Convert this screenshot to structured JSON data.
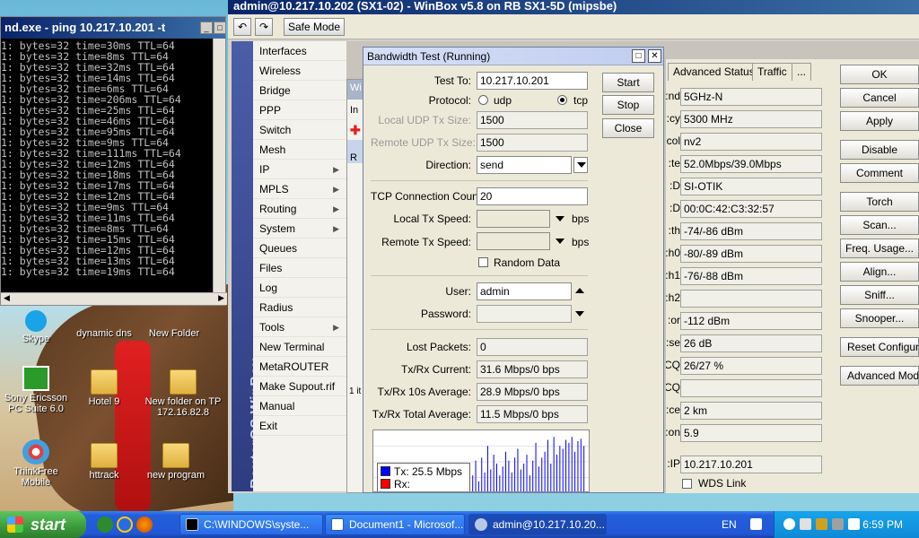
{
  "console": {
    "title": "nd.exe - ping 10.217.10.201 -t",
    "lines": [
      "1: bytes=32 time=30ms TTL=64",
      "1: bytes=32 time=8ms TTL=64",
      "1: bytes=32 time=32ms TTL=64",
      "1: bytes=32 time=14ms TTL=64",
      "1: bytes=32 time=6ms TTL=64",
      "1: bytes=32 time=206ms TTL=64",
      "1: bytes=32 time=25ms TTL=64",
      "1: bytes=32 time=46ms TTL=64",
      "1: bytes=32 time=95ms TTL=64",
      "1: bytes=32 time=9ms TTL=64",
      "1: bytes=32 time=111ms TTL=64",
      "1: bytes=32 time=12ms TTL=64",
      "1: bytes=32 time=18ms TTL=64",
      "1: bytes=32 time=17ms TTL=64",
      "1: bytes=32 time=12ms TTL=64",
      "1: bytes=32 time=9ms TTL=64",
      "1: bytes=32 time=11ms TTL=64",
      "1: bytes=32 time=8ms TTL=64",
      "1: bytes=32 time=15ms TTL=64",
      "1: bytes=32 time=12ms TTL=64",
      "1: bytes=32 time=13ms TTL=64",
      "1: bytes=32 time=19ms TTL=64"
    ]
  },
  "desktop_icons": {
    "skype": "Skype",
    "dynamic_dns": "dynamic dns",
    "new_folder": "New Folder",
    "sony": "Sony Ericsson PC Suite 6.0",
    "hotel": "Hotel 9",
    "new_folder_on": "New folder on  TP 172.16.82.8",
    "thinkfree": "ThinkFree Mobile",
    "httrack": "httrack",
    "new_program": "new program"
  },
  "winbox": {
    "title": "admin@10.217.10.202 (SX1-02) - WinBox v5.8 on RB SX1-5D (mipsbe)",
    "safe_mode": "Safe Mode",
    "side_brand": "RouterOS WinBox",
    "menu": [
      {
        "label": "Interfaces",
        "arrow": ""
      },
      {
        "label": "Wireless",
        "arrow": ""
      },
      {
        "label": "Bridge",
        "arrow": ""
      },
      {
        "label": "PPP",
        "arrow": ""
      },
      {
        "label": "Switch",
        "arrow": ""
      },
      {
        "label": "Mesh",
        "arrow": ""
      },
      {
        "label": "IP",
        "arrow": "▶"
      },
      {
        "label": "MPLS",
        "arrow": "▶"
      },
      {
        "label": "Routing",
        "arrow": "▶"
      },
      {
        "label": "System",
        "arrow": "▶"
      },
      {
        "label": "Queues",
        "arrow": ""
      },
      {
        "label": "Files",
        "arrow": ""
      },
      {
        "label": "Log",
        "arrow": ""
      },
      {
        "label": "Radius",
        "arrow": ""
      },
      {
        "label": "Tools",
        "arrow": "▶"
      },
      {
        "label": "New Terminal",
        "arrow": ""
      },
      {
        "label": "MetaROUTER",
        "arrow": ""
      },
      {
        "label": "Make Supout.rif",
        "arrow": ""
      },
      {
        "label": "Manual",
        "arrow": ""
      },
      {
        "label": "Exit",
        "arrow": ""
      }
    ],
    "bg_window": {
      "title": "Wi",
      "tab": "In",
      "row": "R",
      "footer": "1 it"
    }
  },
  "bandwidth_test": {
    "title": "Bandwidth Test (Running)",
    "test_to_label": "Test To:",
    "test_to": "10.217.10.201",
    "protocol_label": "Protocol:",
    "protocol_udp": "udp",
    "protocol_tcp": "tcp",
    "local_udp_label": "Local UDP Tx Size:",
    "local_udp": "1500",
    "remote_udp_label": "Remote UDP Tx Size:",
    "remote_udp": "1500",
    "direction_label": "Direction:",
    "direction": "send",
    "tcp_count_label": "TCP Connection Count:",
    "tcp_count": "20",
    "local_tx_label": "Local Tx Speed:",
    "remote_tx_label": "Remote Tx Speed:",
    "bps": "bps",
    "random_data": "Random Data",
    "user_label": "User:",
    "user": "admin",
    "password_label": "Password:",
    "lost_label": "Lost Packets:",
    "lost": "0",
    "current_label": "Tx/Rx Current:",
    "current": "31.6 Mbps/0 bps",
    "avg10_label": "Tx/Rx 10s Average:",
    "avg10": "28.9 Mbps/0 bps",
    "total_label": "Tx/Rx Total Average:",
    "total": "11.5 Mbps/0 bps",
    "buttons": {
      "start": "Start",
      "stop": "Stop",
      "close": "Close"
    },
    "legend_tx": "Tx:  25.5 Mbps",
    "legend_rx": "Rx:",
    "colors": {
      "tx": "#0000ff",
      "rx": "#ff0000"
    }
  },
  "interface_window": {
    "tabs": [
      "Advanced Status",
      "Traffic",
      "..."
    ],
    "rows": [
      {
        "label": "nd:",
        "value": "5GHz-N"
      },
      {
        "label": "cy:",
        "value": "5300 MHz"
      },
      {
        "label": "col:",
        "value": "nv2"
      },
      {
        "label": "te:",
        "value": "52.0Mbps/39.0Mbps"
      },
      {
        "label": "D:",
        "value": "SI-OTIK"
      },
      {
        "label": "D:",
        "value": "00:0C:42:C3:32:57"
      },
      {
        "label": "th:",
        "value": "-74/-86 dBm"
      },
      {
        "label": "h0:",
        "value": "-80/-89 dBm"
      },
      {
        "label": "h1:",
        "value": "-76/-88 dBm"
      },
      {
        "label": "h2:",
        "value": ""
      },
      {
        "label": "or:",
        "value": "-112 dBm"
      },
      {
        "label": "se:",
        "value": "26 dB"
      },
      {
        "label": "CQ:",
        "value": "26/27 %"
      },
      {
        "label": "CQ:",
        "value": ""
      },
      {
        "label": "ce:",
        "value": "2 km"
      },
      {
        "label": "on:",
        "value": "5.9"
      },
      {
        "label": "IP:",
        "value": "10.217.10.201"
      }
    ],
    "wds_link": "WDS Link",
    "buttons": [
      "OK",
      "Cancel",
      "Apply",
      "Disable",
      "Comment",
      "Torch",
      "Scan...",
      "Freq. Usage...",
      "Align...",
      "Sniff...",
      "Snooper...",
      "Reset Configuration",
      "Advanced Mode"
    ]
  },
  "taskbar": {
    "start": "start",
    "tasks": [
      "C:\\WINDOWS\\syste...",
      "Document1 - Microsof...",
      "admin@10.217.10.20..."
    ],
    "lang": "EN",
    "clock": "6:59 PM"
  },
  "graph_bars": [
    0.1,
    0.25,
    0.3,
    0.55,
    0.2,
    0.6,
    0.35,
    0.8,
    0.4,
    0.65,
    0.5,
    0.3,
    0.45,
    0.7,
    0.55,
    0.35,
    0.6,
    0.75,
    0.4,
    0.5,
    0.65,
    0.3,
    0.55,
    0.85,
    0.45,
    0.6,
    0.7,
    0.9,
    0.5,
    0.95,
    0.65,
    0.8,
    0.75,
    0.9,
    0.85,
    0.95,
    0.7,
    0.88,
    0.92,
    0.8
  ]
}
